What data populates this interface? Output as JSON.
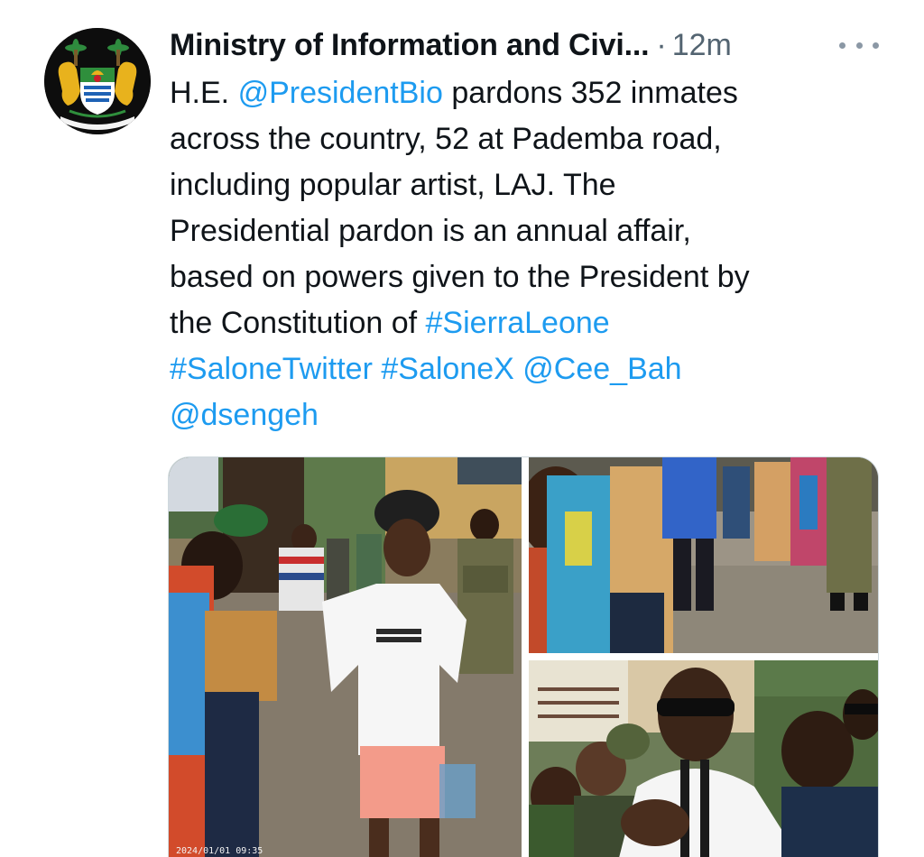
{
  "author": {
    "name": "Ministry of Information and Civi...",
    "separator": "·",
    "time": "12m",
    "avatar_icon": "sierra-leone-coat-of-arms-icon"
  },
  "more_icon": "more-horizontal-icon",
  "tweet": {
    "lines": [
      [
        {
          "t": "H.E. ",
          "link": false
        },
        {
          "t": "@PresidentBio",
          "link": true
        },
        {
          "t": " pardons 352 inmates",
          "link": false
        }
      ],
      [
        {
          "t": "across the country, 52 at Pademba road,",
          "link": false
        }
      ],
      [
        {
          "t": "including popular artist, LAJ. The",
          "link": false
        }
      ],
      [
        {
          "t": "Presidential pardon is an annual affair,",
          "link": false
        }
      ],
      [
        {
          "t": "based on powers given to the President by",
          "link": false
        }
      ],
      [
        {
          "t": "the Constitution of ",
          "link": false
        },
        {
          "t": "#SierraLeone",
          "link": true
        }
      ],
      [
        {
          "t": "#SaloneTwitter",
          "link": true
        },
        {
          "t": " ",
          "link": false
        },
        {
          "t": "#SaloneX",
          "link": true
        },
        {
          "t": " ",
          "link": false
        },
        {
          "t": "@Cee_Bah",
          "link": true
        }
      ],
      [
        {
          "t": "@dsengeh",
          "link": true
        }
      ]
    ]
  },
  "photos": [
    {
      "name": "photo-released-man-white-shirt",
      "stamp": "2024/01/01 09:35"
    },
    {
      "name": "photo-crowd-courtyard"
    },
    {
      "name": "photo-artist-sunglasses-speaking"
    }
  ],
  "colors": {
    "link": "#1d9bf0",
    "text": "#0f1419",
    "muted": "#536471"
  }
}
